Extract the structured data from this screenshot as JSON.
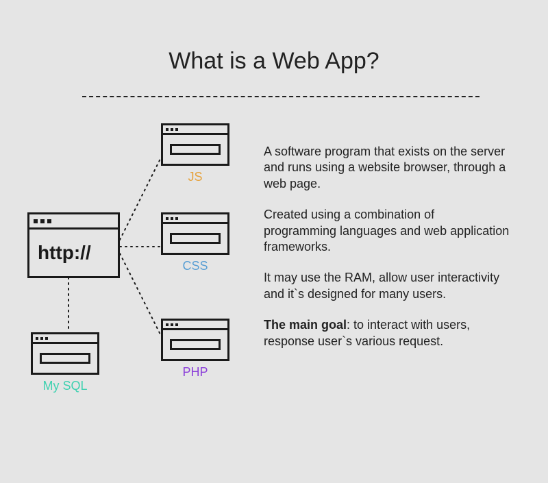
{
  "title": "What is a Web App?",
  "diagram": {
    "http_label": "http://",
    "nodes": {
      "js": "JS",
      "css": "CSS",
      "php": "PHP",
      "mysql": "My SQL"
    }
  },
  "paragraphs": {
    "p1": "A software program that exists on the server and runs using a website browser, through a web page.",
    "p2": "Created using a combination of programming languages and web application frameworks.",
    "p3": "It may use the RAM, allow user interactivity and it`s designed for many users.",
    "p4_bold": "The main goal",
    "p4_rest": ": to interact with users, response user`s various request."
  }
}
